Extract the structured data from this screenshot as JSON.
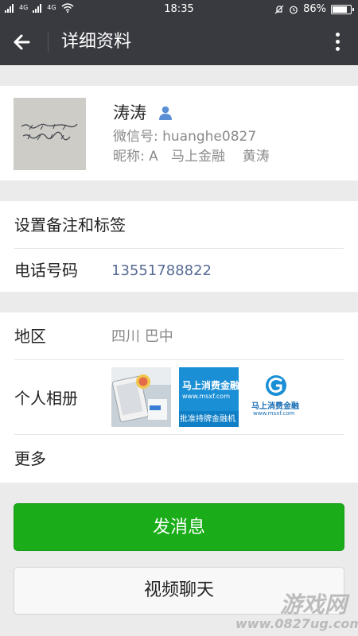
{
  "status_bar": {
    "sim1": "4G",
    "sim2": "4G",
    "time": "18:35",
    "battery_text": "86%",
    "battery_level": 0.86
  },
  "nav": {
    "title": "详细资料",
    "back_icon": "arrow-left-icon",
    "more_icon": "more-vertical-icon"
  },
  "profile": {
    "name": "涛涛",
    "wechat_id": "微信号: huanghe0827",
    "nickname": "昵称: A   马上金融    黄涛"
  },
  "rows": {
    "remark_label": "设置备注和标签",
    "phone_label": "电话号码",
    "phone_value": "13551788822",
    "region_label": "地区",
    "region_value": "四川  巴中",
    "album_label": "个人相册",
    "more_label": "更多"
  },
  "album": {
    "photo2_title": "马上消费金融",
    "photo2_url": "www.msxf.com",
    "photo2_bottom": "批准持牌金融机",
    "photo3_title": "马上消费金融",
    "photo3_url": "www.msxf.com"
  },
  "buttons": {
    "send_message": "发消息",
    "video_chat": "视频聊天"
  },
  "watermark": {
    "top": "游戏网",
    "bottom": "www.0827ug.com"
  },
  "colors": {
    "nav_bg": "#393a3f",
    "accent_green": "#1aad19",
    "phone_link": "#576b95"
  }
}
